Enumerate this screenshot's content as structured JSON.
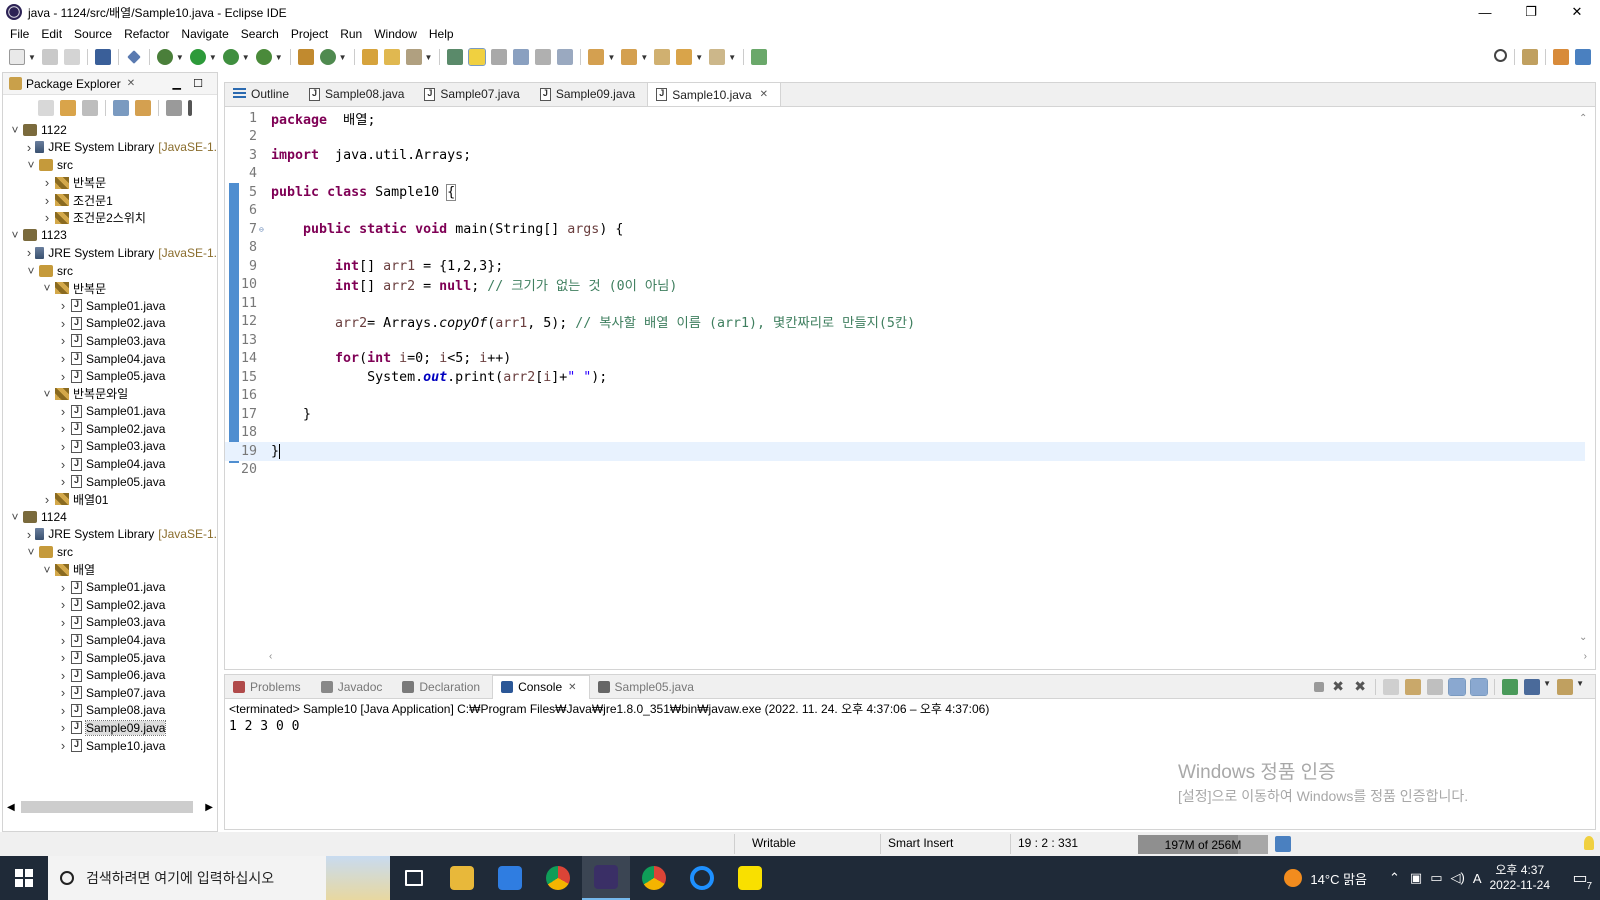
{
  "window": {
    "title": "java - 1124/src/배열/Sample10.java - Eclipse IDE",
    "controls": [
      "—",
      "❐",
      "✕"
    ]
  },
  "menu": [
    "File",
    "Edit",
    "Source",
    "Refactor",
    "Navigate",
    "Search",
    "Project",
    "Run",
    "Window",
    "Help"
  ],
  "package_explorer": {
    "title": "Package Explorer",
    "tree": [
      {
        "depth": 0,
        "arrow": "down",
        "icon": "project",
        "label": "1122",
        "suffix": ""
      },
      {
        "depth": 1,
        "arrow": "right",
        "icon": "lib",
        "label": "JRE System Library",
        "suffix": "[JavaSE-1."
      },
      {
        "depth": 1,
        "arrow": "down",
        "icon": "src",
        "label": "src",
        "suffix": ""
      },
      {
        "depth": 2,
        "arrow": "right",
        "icon": "pkg",
        "label": "반복문",
        "suffix": ""
      },
      {
        "depth": 2,
        "arrow": "right",
        "icon": "pkg",
        "label": "조건문1",
        "suffix": ""
      },
      {
        "depth": 2,
        "arrow": "right",
        "icon": "pkg",
        "label": "조건문2스위치",
        "suffix": ""
      },
      {
        "depth": 0,
        "arrow": "down",
        "icon": "project",
        "label": "1123",
        "suffix": ""
      },
      {
        "depth": 1,
        "arrow": "right",
        "icon": "lib",
        "label": "JRE System Library",
        "suffix": "[JavaSE-1."
      },
      {
        "depth": 1,
        "arrow": "down",
        "icon": "src",
        "label": "src",
        "suffix": ""
      },
      {
        "depth": 2,
        "arrow": "down",
        "icon": "pkg",
        "label": "반복문",
        "suffix": ""
      },
      {
        "depth": 3,
        "arrow": "right",
        "icon": "java",
        "label": "Sample01.java",
        "suffix": ""
      },
      {
        "depth": 3,
        "arrow": "right",
        "icon": "java",
        "label": "Sample02.java",
        "suffix": ""
      },
      {
        "depth": 3,
        "arrow": "right",
        "icon": "java",
        "label": "Sample03.java",
        "suffix": ""
      },
      {
        "depth": 3,
        "arrow": "right",
        "icon": "java",
        "label": "Sample04.java",
        "suffix": ""
      },
      {
        "depth": 3,
        "arrow": "right",
        "icon": "java",
        "label": "Sample05.java",
        "suffix": ""
      },
      {
        "depth": 2,
        "arrow": "down",
        "icon": "pkg",
        "label": "반복문와일",
        "suffix": ""
      },
      {
        "depth": 3,
        "arrow": "right",
        "icon": "java",
        "label": "Sample01.java",
        "suffix": ""
      },
      {
        "depth": 3,
        "arrow": "right",
        "icon": "java",
        "label": "Sample02.java",
        "suffix": ""
      },
      {
        "depth": 3,
        "arrow": "right",
        "icon": "java",
        "label": "Sample03.java",
        "suffix": ""
      },
      {
        "depth": 3,
        "arrow": "right",
        "icon": "java",
        "label": "Sample04.java",
        "suffix": ""
      },
      {
        "depth": 3,
        "arrow": "right",
        "icon": "java",
        "label": "Sample05.java",
        "suffix": ""
      },
      {
        "depth": 2,
        "arrow": "right",
        "icon": "pkg",
        "label": "배열01",
        "suffix": ""
      },
      {
        "depth": 0,
        "arrow": "down",
        "icon": "project",
        "label": "1124",
        "suffix": ""
      },
      {
        "depth": 1,
        "arrow": "right",
        "icon": "lib",
        "label": "JRE System Library",
        "suffix": "[JavaSE-1."
      },
      {
        "depth": 1,
        "arrow": "down",
        "icon": "src",
        "label": "src",
        "suffix": ""
      },
      {
        "depth": 2,
        "arrow": "down",
        "icon": "pkg",
        "label": "배열",
        "suffix": ""
      },
      {
        "depth": 3,
        "arrow": "right",
        "icon": "java",
        "label": "Sample01.java",
        "suffix": ""
      },
      {
        "depth": 3,
        "arrow": "right",
        "icon": "java",
        "label": "Sample02.java",
        "suffix": ""
      },
      {
        "depth": 3,
        "arrow": "right",
        "icon": "java",
        "label": "Sample03.java",
        "suffix": ""
      },
      {
        "depth": 3,
        "arrow": "right",
        "icon": "java",
        "label": "Sample04.java",
        "suffix": ""
      },
      {
        "depth": 3,
        "arrow": "right",
        "icon": "java",
        "label": "Sample05.java",
        "suffix": ""
      },
      {
        "depth": 3,
        "arrow": "right",
        "icon": "java",
        "label": "Sample06.java",
        "suffix": ""
      },
      {
        "depth": 3,
        "arrow": "right",
        "icon": "java",
        "label": "Sample07.java",
        "suffix": ""
      },
      {
        "depth": 3,
        "arrow": "right",
        "icon": "java",
        "label": "Sample08.java",
        "suffix": ""
      },
      {
        "depth": 3,
        "arrow": "right",
        "icon": "java",
        "label": "Sample09.java",
        "suffix": "",
        "selected": true
      },
      {
        "depth": 3,
        "arrow": "right",
        "icon": "java",
        "label": "Sample10.java",
        "suffix": ""
      }
    ]
  },
  "editor": {
    "tabs": [
      {
        "label": "Outline",
        "icon": "outline",
        "active": false
      },
      {
        "label": "Sample08.java",
        "icon": "java",
        "active": false
      },
      {
        "label": "Sample07.java",
        "icon": "java",
        "active": false
      },
      {
        "label": "Sample09.java",
        "icon": "java",
        "active": false
      },
      {
        "label": "Sample10.java",
        "icon": "java",
        "active": true
      }
    ],
    "current_line": 19,
    "lines": [
      [
        [
          "kw",
          "package"
        ],
        [
          "",
          "  배열;"
        ]
      ],
      [],
      [
        [
          "kw",
          "import"
        ],
        [
          "",
          "  java.util.Arrays;"
        ]
      ],
      [],
      [
        [
          "kw",
          "public"
        ],
        [
          "",
          " "
        ],
        [
          "kw",
          "class"
        ],
        [
          "",
          " Sample10 "
        ],
        [
          "brk",
          "{"
        ]
      ],
      [],
      [
        [
          "",
          "    "
        ],
        [
          "kw",
          "public"
        ],
        [
          "",
          " "
        ],
        [
          "kw",
          "static"
        ],
        [
          "",
          " "
        ],
        [
          "kw",
          "void"
        ],
        [
          "",
          " main(String[] "
        ],
        [
          "var",
          "args"
        ],
        [
          "",
          ") {"
        ]
      ],
      [],
      [
        [
          "",
          "        "
        ],
        [
          "kw",
          "int"
        ],
        [
          "",
          "[] "
        ],
        [
          "var",
          "arr1"
        ],
        [
          "",
          " = {1,2,3};"
        ]
      ],
      [
        [
          "",
          "        "
        ],
        [
          "kw",
          "int"
        ],
        [
          "",
          "[] "
        ],
        [
          "var",
          "arr2"
        ],
        [
          "",
          " = "
        ],
        [
          "kw",
          "null"
        ],
        [
          "",
          "; "
        ],
        [
          "cmt",
          "// 크기가 없는 것 (0이 아님)"
        ]
      ],
      [],
      [
        [
          "",
          "        "
        ],
        [
          "var",
          "arr2"
        ],
        [
          "",
          "= Arrays."
        ],
        [
          "itl",
          "copyOf"
        ],
        [
          "",
          "("
        ],
        [
          "var",
          "arr1"
        ],
        [
          "",
          ", 5); "
        ],
        [
          "cmt",
          "// 복사할 배열 이름 (arr1), 몇칸짜리로 만들지(5칸)"
        ]
      ],
      [],
      [
        [
          "",
          "        "
        ],
        [
          "kw",
          "for"
        ],
        [
          "",
          "("
        ],
        [
          "kw",
          "int"
        ],
        [
          "",
          " "
        ],
        [
          "var",
          "i"
        ],
        [
          "",
          "=0; "
        ],
        [
          "var",
          "i"
        ],
        [
          "",
          "<5; "
        ],
        [
          "var",
          "i"
        ],
        [
          "",
          "++)"
        ]
      ],
      [
        [
          "",
          "            System."
        ],
        [
          "fld",
          "out"
        ],
        [
          "",
          ".print("
        ],
        [
          "var",
          "arr2"
        ],
        [
          "",
          "["
        ],
        [
          "var",
          "i"
        ],
        [
          "",
          "]+"
        ],
        [
          "str",
          "\" \""
        ],
        [
          "",
          ");"
        ]
      ],
      [],
      [
        [
          "",
          "    }"
        ]
      ],
      [],
      [
        [
          "",
          "}"
        ]
      ],
      []
    ],
    "fold_lines": [
      7
    ]
  },
  "bottom_panel": {
    "tabs": [
      {
        "label": "Problems",
        "active": false,
        "color": "#b04a4a"
      },
      {
        "label": "Javadoc",
        "active": false,
        "color": "#888888"
      },
      {
        "label": "Declaration",
        "active": false,
        "color": "#7a7a7a"
      },
      {
        "label": "Console",
        "active": true,
        "color": "#2b5797"
      },
      {
        "label": "Sample05.java",
        "active": false,
        "color": "#666666"
      }
    ],
    "console_status": "<terminated> Sample10 [Java Application] C:₩Program Files₩Java₩jre1.8.0_351₩bin₩javaw.exe  (2022. 11. 24. 오후 4:37:06 – 오후 4:37:06)",
    "console_output": "1 2 3 0 0",
    "watermark_line1": "Windows 정품 인증",
    "watermark_line2": "[설정]으로 이동하여 Windows를 정품 인증합니다."
  },
  "statusbar": {
    "writable": "Writable",
    "insert_mode": "Smart Insert",
    "position": "19 : 2 : 331",
    "heap": "197M of 256M",
    "heap_fraction": 0.77
  },
  "taskbar": {
    "search_placeholder": "검색하려면 여기에 입력하십시오",
    "apps": [
      {
        "name": "task-view-icon",
        "color": "#1f2a38",
        "active": false
      },
      {
        "name": "file-explorer-icon",
        "color": "#e8b83a",
        "active": false
      },
      {
        "name": "microsoft-store-icon",
        "color": "#2f7de1",
        "active": false
      },
      {
        "name": "chrome-icon",
        "color": "#db4437",
        "active": false
      },
      {
        "name": "eclipse-icon",
        "color": "#3a2f66",
        "active": true
      },
      {
        "name": "chrome-profile-icon",
        "color": "#db4437",
        "active": false
      },
      {
        "name": "internet-explorer-icon",
        "color": "#1e90ff",
        "active": false
      },
      {
        "name": "kakaotalk-icon",
        "color": "#f9e000",
        "active": false
      }
    ],
    "weather": "14°C 맑음",
    "ime": "A",
    "time": "오후 4:37",
    "date": "2022-11-24",
    "notifications": "7"
  },
  "colors": {
    "keyword": "#7f0055",
    "comment": "#3f7f5f",
    "string": "#2a00ff",
    "line_highlight": "#e8f2fe",
    "ruler": "#4f8ed0",
    "taskbar": "#1f2a38"
  }
}
